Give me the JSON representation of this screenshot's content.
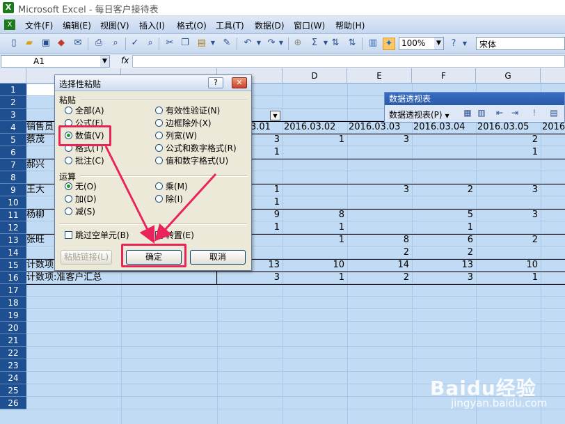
{
  "window": {
    "title": "Microsoft Excel - 每日客户接待表"
  },
  "menu": [
    "文件(F)",
    "编辑(E)",
    "视图(V)",
    "插入(I)",
    "格式(O)",
    "工具(T)",
    "数据(D)",
    "窗口(W)",
    "帮助(H)"
  ],
  "toolbar": {
    "zoom": "100%",
    "font": "宋体"
  },
  "formula_bar": {
    "cell_ref": "A1",
    "fx": "fx",
    "value": ""
  },
  "columns": [
    "D",
    "E",
    "F",
    "G"
  ],
  "rows": [
    "1",
    "2",
    "3",
    "4",
    "5",
    "6",
    "7",
    "8",
    "9",
    "10",
    "11",
    "12",
    "13",
    "14",
    "15",
    "16",
    "17",
    "18",
    "19",
    "20",
    "21",
    "22",
    "23",
    "24",
    "25",
    "26"
  ],
  "sheet": {
    "row4_dates": [
      "3.01",
      "2016.03.02",
      "2016.03.03",
      "2016.03.04",
      "2016.03.05",
      "2016"
    ],
    "names": {
      "r4": "销售员",
      "r5": "蔡茂",
      "r7": "郝兴",
      "r9": "王大",
      "r11": "杨柳",
      "r13": "张旺",
      "r15": "计数项:客户姓名汇总",
      "r16": "计数项:准客户汇总"
    },
    "values": {
      "r5": [
        "3",
        "1",
        "3",
        "",
        "2"
      ],
      "r6": [
        "1",
        "",
        "",
        "",
        "1"
      ],
      "r9": [
        "1",
        "",
        "3",
        "2",
        "3"
      ],
      "r10": [
        "1",
        "",
        "",
        "",
        ""
      ],
      "r11": [
        "9",
        "8",
        "",
        "5",
        "3"
      ],
      "r12": [
        "1",
        "1",
        "",
        "1",
        ""
      ],
      "r13": [
        "",
        "1",
        "8",
        "6",
        "2"
      ],
      "r14": [
        "",
        "",
        "2",
        "2",
        ""
      ],
      "r15": [
        "13",
        "10",
        "14",
        "13",
        "10"
      ],
      "r16": [
        "3",
        "1",
        "2",
        "3",
        "1"
      ]
    }
  },
  "pivot_toolbar": {
    "title": "数据透视表",
    "menu_label": "数据透视表(P)"
  },
  "dialog": {
    "title": "选择性粘贴",
    "paste_group": "粘贴",
    "paste_left": [
      "全部(A)",
      "公式(F)",
      "数值(V)",
      "格式(T)",
      "批注(C)"
    ],
    "paste_right": [
      "有效性验证(N)",
      "边框除外(X)",
      "列宽(W)",
      "公式和数字格式(R)",
      "值和数字格式(U)"
    ],
    "selected_paste": "数值(V)",
    "operation_group": "运算",
    "op_left": [
      "无(O)",
      "加(D)",
      "减(S)"
    ],
    "op_right": [
      "乘(M)",
      "除(I)"
    ],
    "selected_op": "无(O)",
    "skip_blanks": "跳过空单元(B)",
    "transpose": "转置(E)",
    "paste_link": "粘贴链接(L)",
    "ok": "确定",
    "cancel": "取消"
  },
  "watermark": {
    "main": "Baidu经验",
    "sub": "jingyan.baidu.com"
  },
  "colors": {
    "highlight": "#e8245a",
    "row_header": "#1d4f91",
    "grid_bg": "#c2dbf4"
  }
}
